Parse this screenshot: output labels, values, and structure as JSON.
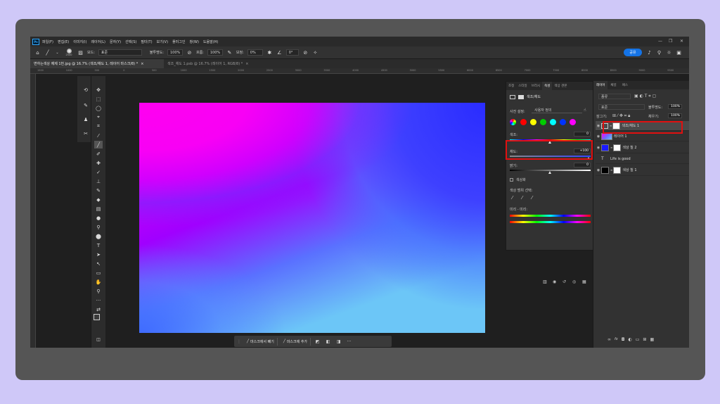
{
  "menu": {
    "app_icon": "Ps",
    "items": [
      "파일(F)",
      "편집(E)",
      "이미지(I)",
      "레이어(L)",
      "문자(Y)",
      "선택(S)",
      "필터(T)",
      "보기(V)",
      "플러그인",
      "창(W)",
      "도움말(H)"
    ],
    "window_controls": [
      "—",
      "❐",
      "✕"
    ]
  },
  "options": {
    "brush_size": "2500",
    "mode_label": "모드:",
    "mode_value": "표준",
    "opacity_label": "불투명도:",
    "opacity_value": "100%",
    "flow_label": "흐름:",
    "flow_value": "100%",
    "smoothing_label": "보정:",
    "smoothing_value": "0%",
    "angle_value": "0°",
    "share_label": "공유"
  },
  "tabs": [
    {
      "label": "변하는색상 예제 1번.jpg @ 16.7% (색조/채도 1, 레이어 마스크/8) *",
      "close": "×"
    },
    {
      "label": "색조_채도 1.psb @ 16.7% (레이어 1, RGB/8) *",
      "close": "×"
    }
  ],
  "ruler": {
    "ticks": [
      "1500",
      "1000",
      "500",
      "0",
      "500",
      "1000",
      "1500",
      "2000",
      "2500",
      "3000",
      "3500",
      "4000",
      "4500",
      "5000",
      "5500",
      "6000",
      "6500",
      "7000",
      "7500",
      "8000",
      "8500",
      "9000",
      "9500"
    ],
    "origin": "2400"
  },
  "mask_bar": {
    "subtract_label": "마스크에서 빼기",
    "add_label": "마스크에 추가",
    "more": "···"
  },
  "properties": {
    "tabs": [
      "조정",
      "스타일",
      "브러시",
      "속성",
      "색상 견본"
    ],
    "active_tab": "속성",
    "header": "색조/채도",
    "preset_label": "사전 설정:",
    "preset_value": "사용자 정의",
    "hue_label": "색조:",
    "hue_value": "0",
    "saturation_label": "채도:",
    "saturation_value": "+100",
    "lightness_label": "밝기:",
    "lightness_value": "0",
    "colorize_label": "색상화",
    "range_label": "색상 범위 선택:",
    "replacement_label": "미리 - 미리:",
    "colors": [
      "#ff0000",
      "#ffff00",
      "#00cc00",
      "#00ffff",
      "#0033ff",
      "#ff00ff"
    ],
    "saturation_fraction": 1.0,
    "hue_fraction": 0.5,
    "lightness_fraction": 0.5
  },
  "layers": {
    "tabs": [
      "레이어",
      "채널",
      "패스"
    ],
    "kind_label": "종류",
    "blend_label": "표준",
    "opacity_label": "불투명도:",
    "opacity_value": "100%",
    "lock_label": "잠그기:",
    "fill_label": "채우기:",
    "fill_value": "100%",
    "rows": [
      {
        "name": "색조/채도 1",
        "type": "adjustment"
      },
      {
        "name": "레이어 1",
        "type": "image"
      },
      {
        "name": "색상 칠 2",
        "type": "fill-blue"
      },
      {
        "name": "Life is good",
        "type": "text"
      },
      {
        "name": "색상 칠 1",
        "type": "fill-black"
      }
    ],
    "text_glyph": "T",
    "fx_label": "fx"
  }
}
